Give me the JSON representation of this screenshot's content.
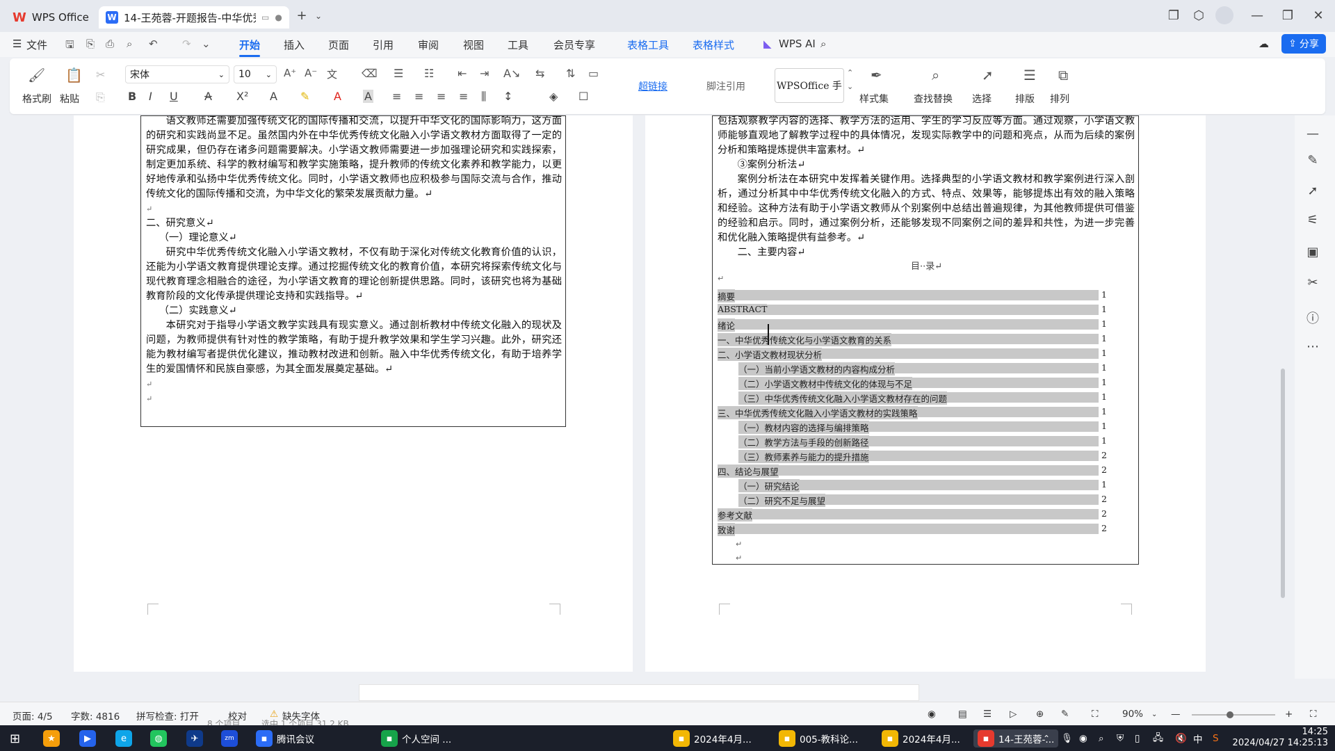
{
  "titlebar": {
    "app_tab": "WPS Office",
    "doc_tab": "14-王苑蓉-开题报告-中华优秀",
    "add_tab": "+"
  },
  "menu": {
    "file": "文件",
    "items": [
      "开始",
      "插入",
      "页面",
      "引用",
      "审阅",
      "视图",
      "工具",
      "会员专享",
      "表格工具",
      "表格样式",
      "WPS AI"
    ],
    "share": "分享"
  },
  "ribbon": {
    "format_painter": "格式刷",
    "paste": "粘贴",
    "font_name": "宋体",
    "font_size": "10",
    "hyperlink": "超链接",
    "footnote_ref": "脚注引用",
    "style_preview": "WPSOffice 手",
    "style_set": "样式集",
    "find_replace": "查找替换",
    "select": "选择",
    "layout": "排版",
    "arrange": "排列"
  },
  "page_left": {
    "paragraphs": [
      {
        "type": "body",
        "text": "语文教师还需要加强传统文化的国际传播和交流，以提升中华文化的国际影响力，这方面的研究和实践尚显不足。虽然国内外在中华优秀传统文化融入小学语文教材方面取得了一定的研究成果，但仍存在诸多问题需要解决。小学语文教师需要进一步加强理论研究和实践探索，制定更加系统、科学的教材编写和教学实施策略，提升教师的传统文化素养和教学能力，以更好地传承和弘扬中华优秀传统文化。同时，小学语文教师也应积极参与国际交流与合作，推动传统文化的国际传播和交流，为中华文化的繁荣发展贡献力量。↵"
      },
      {
        "type": "blank",
        "text": "↵"
      },
      {
        "type": "heading",
        "text": "二、研究意义↵"
      },
      {
        "type": "sub",
        "text": "（一）理论意义↵"
      },
      {
        "type": "body",
        "text": "研究中华优秀传统文化融入小学语文教材，不仅有助于深化对传统文化教育价值的认识，还能为小学语文教育提供理论支撑。通过挖掘传统文化的教育价值，本研究将探索传统文化与现代教育理念相融合的途径，为小学语文教育的理论创新提供思路。同时，该研究也将为基础教育阶段的文化传承提供理论支持和实践指导。↵"
      },
      {
        "type": "sub",
        "text": "（二）实践意义↵"
      },
      {
        "type": "body",
        "text": "本研究对于指导小学语文教学实践具有现实意义。通过剖析教材中传统文化融入的现状及问题，为教师提供有针对性的教学策略，有助于提升教学效果和学生学习兴趣。此外，研究还能为教材编写者提供优化建议，推动教材改进和创新。融入中华优秀传统文化，有助于培养学生的爱国情怀和民族自豪感，为其全面发展奠定基础。↵"
      },
      {
        "type": "blank",
        "text": "↵"
      },
      {
        "type": "blank",
        "text": "↵"
      }
    ]
  },
  "page_right": {
    "paragraphs": [
      {
        "type": "cont",
        "text": "包括观察教学内容的选择、教学方法的运用、学生的学习反应等方面。通过观察，小学语文教师能够直观地了解教学过程中的具体情况，发现实际教学中的问题和亮点，从而为后续的案例分析和策略提炼提供丰富素材。↵"
      },
      {
        "type": "sub2",
        "text": "③案例分析法↵"
      },
      {
        "type": "body",
        "text": "案例分析法在本研究中发挥着关键作用。选择典型的小学语文教材和教学案例进行深入剖析，通过分析其中中华优秀传统文化融入的方式、特点、效果等，能够提炼出有效的融入策略和经验。这种方法有助于小学语文教师从个别案例中总结出普遍规律，为其他教师提供可借鉴的经验和启示。同时，通过案例分析，还能够发现不同案例之间的差异和共性，为进一步完善和优化融入策略提供有益参考。↵"
      },
      {
        "type": "sub2",
        "text": "二、主要内容↵"
      }
    ],
    "toc_title": "目··录↵",
    "toc_blank": "↵",
    "toc": [
      {
        "label": "摘要",
        "page": "1",
        "level": 0
      },
      {
        "label": "ABSTRACT",
        "page": "1",
        "level": 0
      },
      {
        "label": "绪论",
        "page": "1",
        "level": 0
      },
      {
        "label": "一、中华优秀传统文化与小学语文教育的关系",
        "page": "1",
        "level": 0
      },
      {
        "label": "二、小学语文教材现状分析",
        "page": "1",
        "level": 0
      },
      {
        "label": "（一）当前小学语文教材的内容构成分析",
        "page": "1",
        "level": 1
      },
      {
        "label": "（二）小学语文教材中传统文化的体现与不足",
        "page": "1",
        "level": 1
      },
      {
        "label": "（三）中华优秀传统文化融入小学语文教材存在的问题",
        "page": "1",
        "level": 1
      },
      {
        "label": "三、中华优秀传统文化融入小学语文教材的实践策略",
        "page": "1",
        "level": 0
      },
      {
        "label": "（一）教材内容的选择与编排策略",
        "page": "1",
        "level": 1
      },
      {
        "label": "（二）教学方法与手段的创新路径",
        "page": "1",
        "level": 1
      },
      {
        "label": "（三）教师素养与能力的提升措施",
        "page": "2",
        "level": 1
      },
      {
        "label": "四、结论与展望",
        "page": "2",
        "level": 0
      },
      {
        "label": "（一）研究结论",
        "page": "1",
        "level": 1
      },
      {
        "label": "（二）研究不足与展望",
        "page": "2",
        "level": 1
      },
      {
        "label": "参考文献",
        "page": "2",
        "level": 0
      },
      {
        "label": "致谢",
        "page": "2",
        "level": 0
      }
    ],
    "after_toc": [
      "↵",
      "↵"
    ]
  },
  "statusbar": {
    "page": "页面: 4/5",
    "words": "字数: 4816",
    "spellcheck": "拼写检查: 打开",
    "proof": "校对",
    "missing_font": "缺失字体",
    "zoom": "90%",
    "ghost_items": "8 个项目",
    "ghost_selected": "选中 1 个项目 31.2 KB"
  },
  "taskbar": {
    "apps": [
      {
        "label": "腾讯会议",
        "color": "#2b6cf6"
      },
      {
        "label": "个人空间 ...",
        "color": "#16a34a"
      },
      {
        "label": "2024年4月...",
        "color": "#f2b705"
      },
      {
        "label": "005-教科论...",
        "color": "#f2b705"
      },
      {
        "label": "2024年4月...",
        "color": "#f2b705"
      },
      {
        "label": "14-王苑蓉-...",
        "color": "#e63a2e"
      }
    ],
    "ime": "中",
    "time": "14:25",
    "date": "2024/04/27 14:25:13"
  },
  "colors": {
    "accent": "#1a6cf0",
    "wps_red": "#e63a2e"
  }
}
